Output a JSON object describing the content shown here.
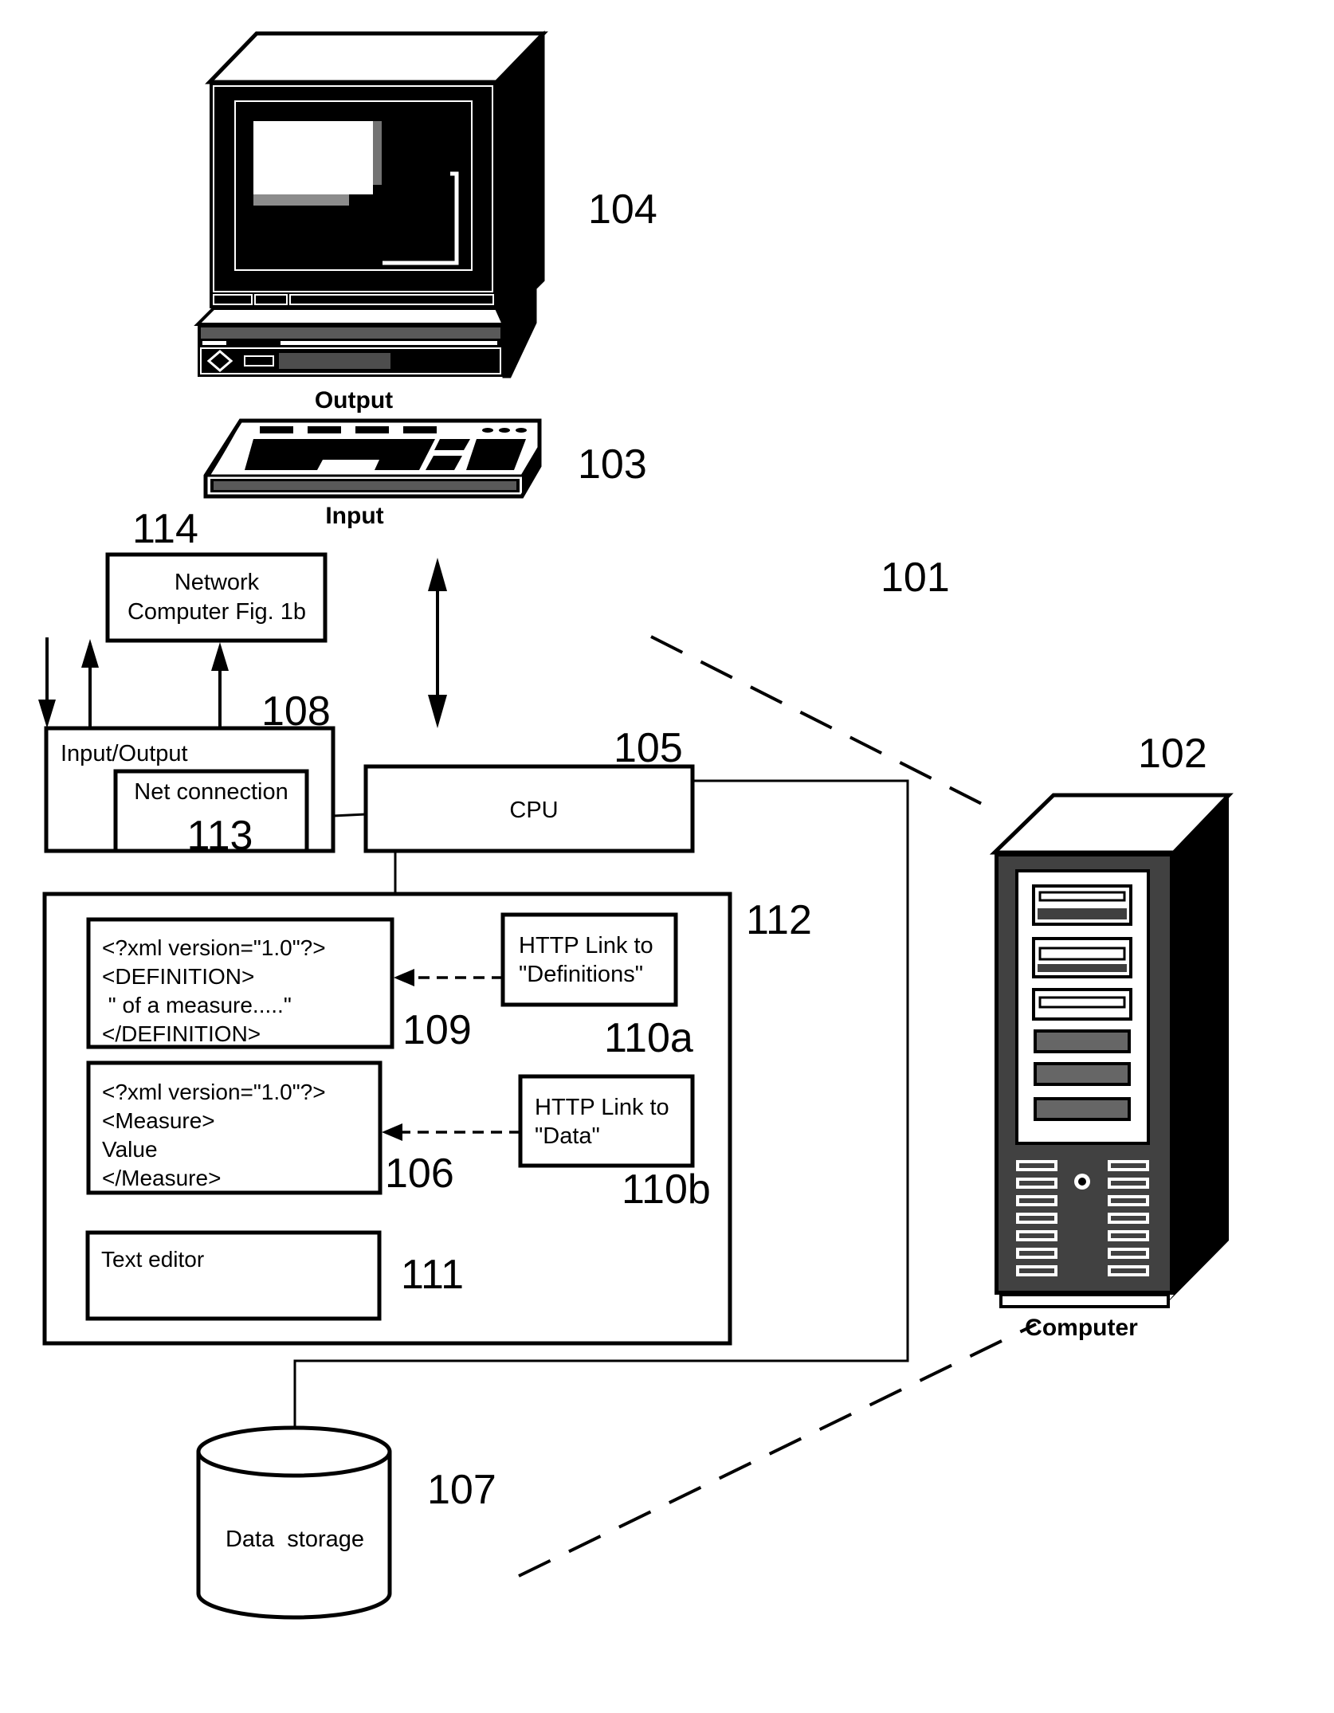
{
  "figure": {
    "description": "Patent-style system diagram of a computer with XML measure definitions and data"
  },
  "components": {
    "monitor": {
      "ref": "104",
      "caption": "Output",
      "icon": "monitor-icon"
    },
    "keyboard": {
      "ref": "103",
      "caption": "Input",
      "icon": "keyboard-icon"
    },
    "system": {
      "ref": "101"
    },
    "server": {
      "ref": "102",
      "caption": "Computer",
      "icon": "server-tower-icon"
    },
    "network_computer": {
      "ref": "114",
      "lines": [
        "Network",
        "Computer Fig. 1b"
      ]
    },
    "io": {
      "ref": "108",
      "label": "Input/Output"
    },
    "net_connection": {
      "ref": "113",
      "label": "Net connection"
    },
    "cpu": {
      "ref": "105",
      "label": "CPU"
    },
    "memory": {
      "ref": "112"
    },
    "xml_definition": {
      "ref": "109",
      "lines": [
        "<?xml version=\"1.0\"?>",
        "<DEFINITION>",
        " \" of a measure.....\"",
        "</DEFINITION>"
      ]
    },
    "link_definitions": {
      "ref": "110a",
      "lines": [
        "HTTP Link to",
        "\"Definitions\""
      ]
    },
    "xml_measure": {
      "ref": "106",
      "lines": [
        "<?xml version=\"1.0\"?>",
        "<Measure>",
        "Value",
        "</Measure>"
      ]
    },
    "link_data": {
      "ref": "110b",
      "lines": [
        "HTTP Link to",
        "\"Data\""
      ]
    },
    "text_editor": {
      "ref": "111",
      "label": "Text editor"
    },
    "data_storage": {
      "ref": "107",
      "label": "Data  storage",
      "icon": "database-cylinder-icon"
    }
  },
  "colors": {
    "ink": "#000000",
    "paper": "#ffffff"
  }
}
